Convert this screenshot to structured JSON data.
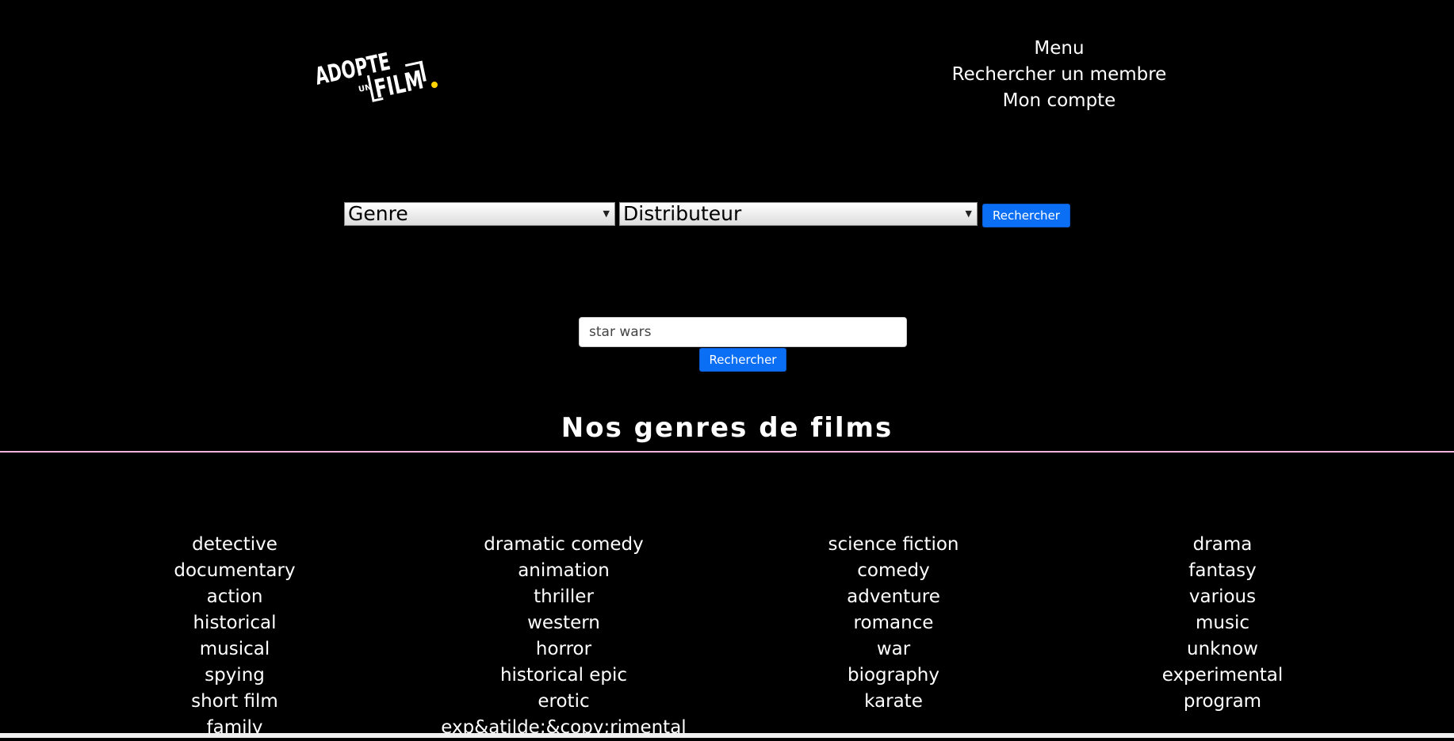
{
  "header": {
    "logo_text": "ADOPTE UN FILM!",
    "menu": [
      "Menu",
      "Rechercher un membre",
      "Mon compte"
    ]
  },
  "filters": {
    "genre_selected": "Genre",
    "distributor_selected": "Distributeur",
    "search_button": "Rechercher"
  },
  "search": {
    "value": "star wars",
    "button": "Rechercher"
  },
  "genres": {
    "title": "Nos genres de films",
    "columns": [
      [
        "detective",
        "documentary",
        "action",
        "historical",
        "musical",
        "spying",
        "short film",
        "family"
      ],
      [
        "dramatic comedy",
        "animation",
        "thriller",
        "western",
        "horror",
        "historical epic",
        "erotic",
        "exp&atilde;&copy;rimental"
      ],
      [
        "science fiction",
        "comedy",
        "adventure",
        "romance",
        "war",
        "biography",
        "karate"
      ],
      [
        "drama",
        "fantasy",
        "various",
        "music",
        "unknow",
        "experimental",
        "program"
      ]
    ]
  },
  "colors": {
    "background": "#000000",
    "accent_button": "#0b6ff5",
    "logo_dot": "#ffd400",
    "divider": "#f2b6dc"
  }
}
